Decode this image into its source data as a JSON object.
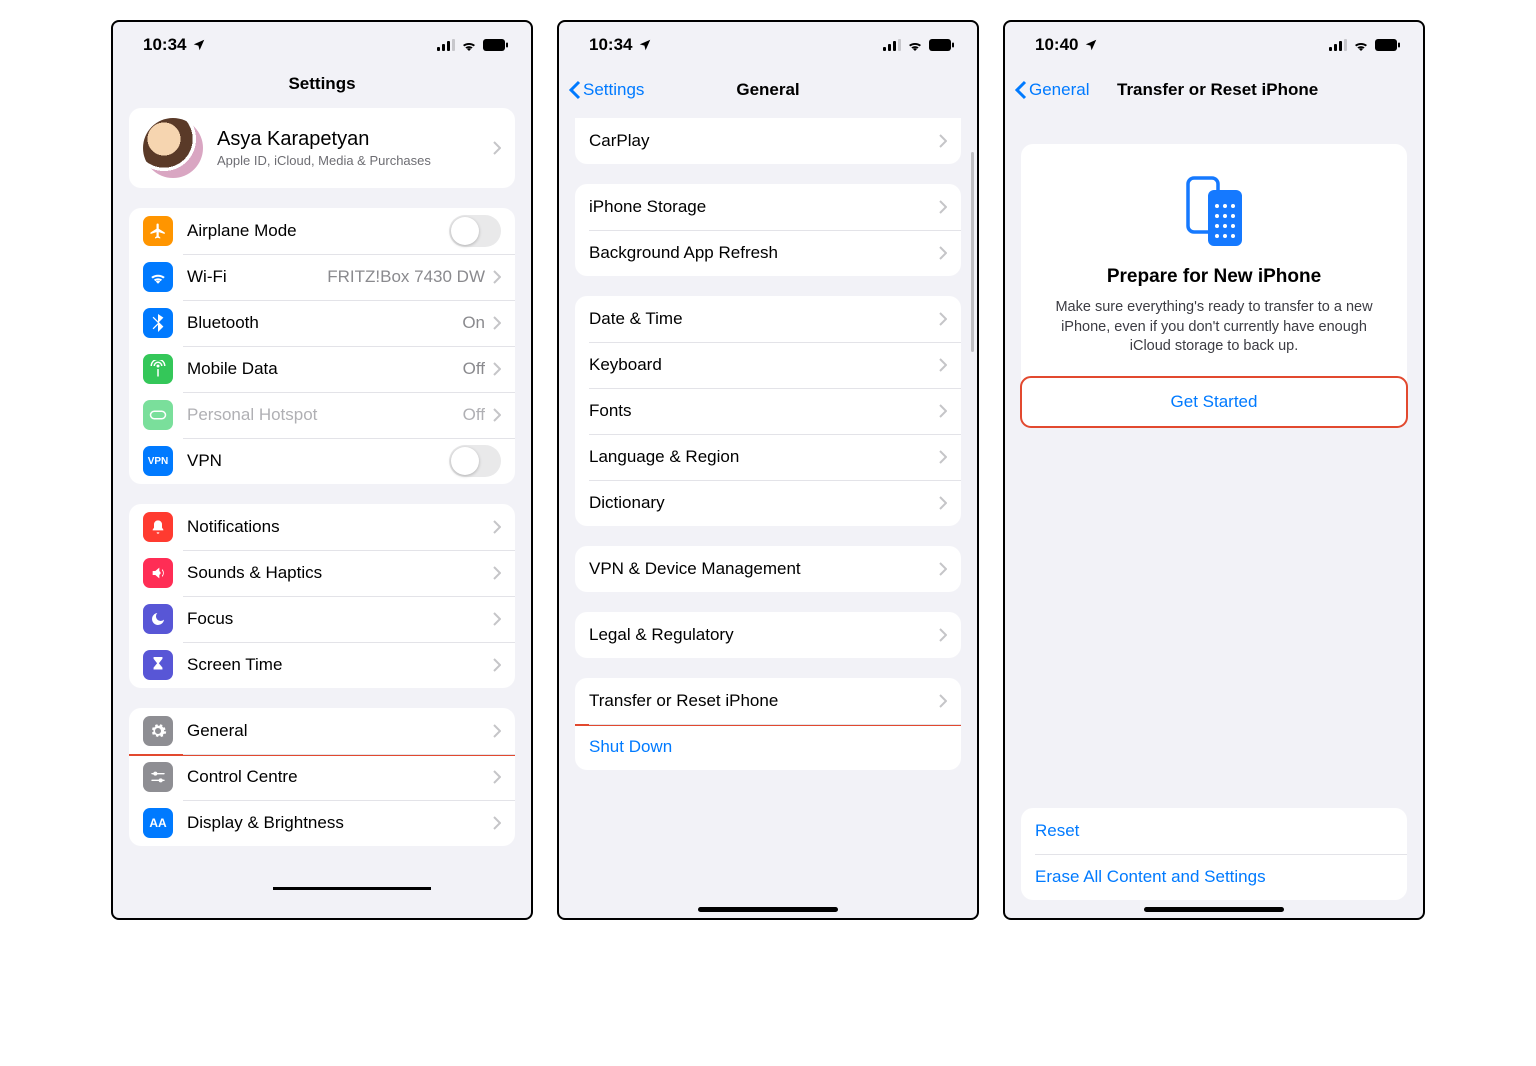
{
  "screens": [
    {
      "status": {
        "time": "10:34"
      },
      "title": "Settings",
      "profile": {
        "name": "Asya Karapetyan",
        "sub": "Apple ID, iCloud, Media & Purchases"
      },
      "g1": [
        {
          "label": "Airplane Mode",
          "kind": "toggle",
          "color": "#ff9500"
        },
        {
          "label": "Wi-Fi",
          "value": "FRITZ!Box 7430 DW",
          "color": "#007aff"
        },
        {
          "label": "Bluetooth",
          "value": "On",
          "color": "#007aff"
        },
        {
          "label": "Mobile Data",
          "value": "Off",
          "color": "#34c759"
        },
        {
          "label": "Personal Hotspot",
          "value": "Off",
          "color": "#34c759",
          "disabled": true
        },
        {
          "label": "VPN",
          "kind": "toggle",
          "color": "#007aff",
          "badge": "VPN"
        }
      ],
      "g2": [
        {
          "label": "Notifications",
          "color": "#ff3b30"
        },
        {
          "label": "Sounds & Haptics",
          "color": "#ff2d55"
        },
        {
          "label": "Focus",
          "color": "#5856d6"
        },
        {
          "label": "Screen Time",
          "color": "#5856d6"
        }
      ],
      "g3": [
        {
          "label": "General",
          "color": "#8e8e93",
          "highlight": true
        },
        {
          "label": "Control Centre",
          "color": "#8e8e93"
        },
        {
          "label": "Display & Brightness",
          "color": "#007aff",
          "badge": "AA"
        }
      ]
    },
    {
      "status": {
        "time": "10:34"
      },
      "back": "Settings",
      "title": "General",
      "rows": [
        [
          {
            "label": "CarPlay"
          }
        ],
        [
          {
            "label": "iPhone Storage"
          },
          {
            "label": "Background App Refresh"
          }
        ],
        [
          {
            "label": "Date & Time"
          },
          {
            "label": "Keyboard"
          },
          {
            "label": "Fonts"
          },
          {
            "label": "Language & Region"
          },
          {
            "label": "Dictionary"
          }
        ],
        [
          {
            "label": "VPN & Device Management"
          }
        ],
        [
          {
            "label": "Legal & Regulatory"
          }
        ],
        [
          {
            "label": "Transfer or Reset iPhone",
            "highlight": true
          },
          {
            "label": "Shut Down",
            "link": true
          }
        ]
      ]
    },
    {
      "status": {
        "time": "10:40"
      },
      "back": "General",
      "title": "Transfer or Reset iPhone",
      "card": {
        "heading": "Prepare for New iPhone",
        "body": "Make sure everything's ready to transfer to a new iPhone, even if you don't currently have enough iCloud storage to back up.",
        "cta": "Get Started"
      },
      "actions": [
        "Reset",
        "Erase All Content and Settings"
      ]
    }
  ]
}
